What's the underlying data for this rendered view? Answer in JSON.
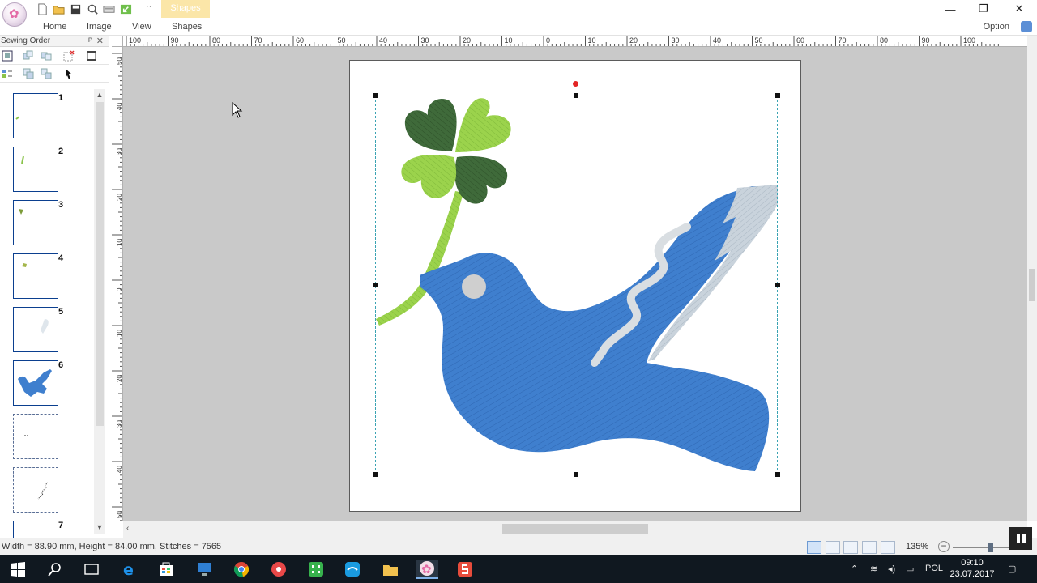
{
  "window": {
    "context_tab_title": "Shapes",
    "controls": {
      "minimize": "—",
      "restore": "❐",
      "close": "✕"
    }
  },
  "ribbon": {
    "tabs": [
      "Home",
      "Image",
      "View",
      "Shapes"
    ],
    "option_label": "Option"
  },
  "sewing_order": {
    "title": "Sewing Order",
    "pin": "ᴘ",
    "close": "✕",
    "items": [
      {
        "number": "1"
      },
      {
        "number": "2"
      },
      {
        "number": "3"
      },
      {
        "number": "4"
      },
      {
        "number": "5"
      },
      {
        "number": "6"
      },
      {
        "number": ""
      },
      {
        "number": ""
      },
      {
        "number": "7"
      }
    ]
  },
  "rulers": {
    "horizontal_labels": [
      "100",
      "90",
      "80",
      "70",
      "60",
      "50",
      "40",
      "30",
      "20",
      "10",
      "0",
      "10",
      "20",
      "30",
      "40",
      "50",
      "60",
      "70",
      "80",
      "90",
      "100"
    ],
    "vertical_labels": [
      "50",
      "40",
      "30",
      "20",
      "10",
      "0",
      "10",
      "20",
      "30",
      "40",
      "50"
    ]
  },
  "status": {
    "text": "Width = 88.90 mm, Height = 84.00 mm, Stitches = 7565",
    "zoom": "135%",
    "zoom_level": 0.66
  },
  "taskbar": {
    "language": "POL",
    "time": "09:10",
    "date": "23.07.2017"
  },
  "colors": {
    "dove": "#3f7fce",
    "clover_dark": "#3f6a3a",
    "clover_light": "#9bd34c",
    "wing": "#c9d3dc",
    "selection": "#3aa3b3",
    "rotate_handle": "#e32424"
  }
}
